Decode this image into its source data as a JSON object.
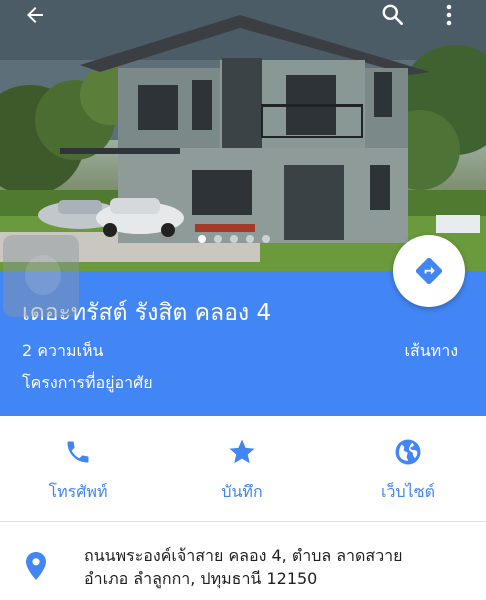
{
  "hero": {
    "photo_subject": "two-story-house",
    "image_count": 5,
    "active_index": 0
  },
  "toolbar": {
    "back_icon": "arrow-back-icon",
    "search_icon": "search-icon",
    "more_icon": "more-vert-icon"
  },
  "place": {
    "name": "เดอะทรัสต์ รังสิต คลอง 4",
    "reviews": "2 ความเห็น",
    "category": "โครงการที่อยู่อาศัย",
    "directions_label": "เส้นทาง"
  },
  "actions": [
    {
      "icon": "phone-icon",
      "label": "โทรศัพท์"
    },
    {
      "icon": "star-icon",
      "label": "บันทึก"
    },
    {
      "icon": "globe-icon",
      "label": "เว็บไซต์"
    }
  ],
  "address": {
    "line1": "ถนนพระองค์เจ้าสาย คลอง 4, ตำบล ลาดสวาย",
    "line2": "อำเภอ ลำลูกกา, ปทุมธานี 12150"
  },
  "colors": {
    "accent": "#4285f4",
    "text_primary": "#212121",
    "background": "#ffffff"
  }
}
